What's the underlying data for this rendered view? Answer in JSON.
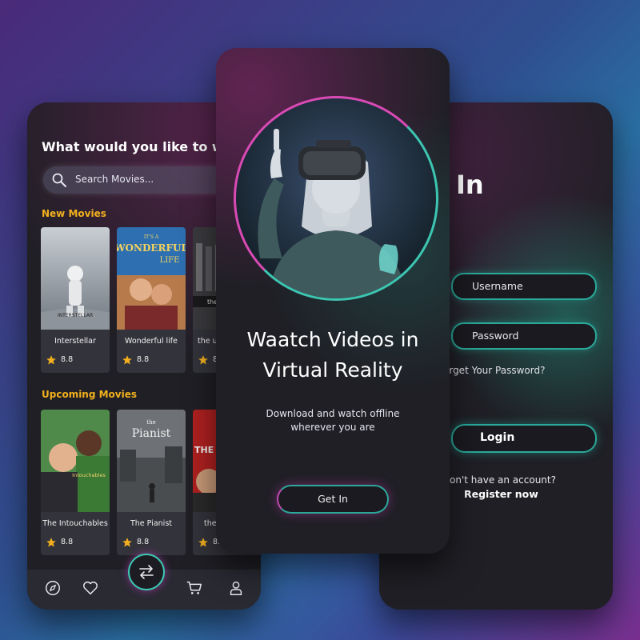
{
  "browse": {
    "greeting": "What would you like to wa",
    "search_placeholder": "Search Movies...",
    "new_movies_label": "New Movies",
    "upcoming_movies_label": "Upcoming Movies",
    "new_movies": [
      {
        "title": "Interstellar",
        "rating": "8.8"
      },
      {
        "title": "Wonderful life",
        "rating": "8.8"
      },
      {
        "title": "the u",
        "rating": "8"
      }
    ],
    "upcoming_movies": [
      {
        "title": "The Intouchables",
        "rating": "8.8"
      },
      {
        "title": "The Pianist",
        "rating": "8.8"
      },
      {
        "title": "the",
        "rating": "8.8"
      }
    ],
    "poster_texts": {
      "interstellar": "INTERSTELLAR",
      "wonderful_small": "IT'S A",
      "wonderful_big": "WONDERFUL",
      "wonderful_life": "LIFE",
      "third_new": "the Usual",
      "intouchables": "Intouchables",
      "pianist_the": "the",
      "pianist": "Pianist",
      "departed": "THE DEPAR"
    },
    "nav_icons": [
      "compass-icon",
      "heart-icon",
      "swap-icon",
      "cart-icon",
      "user-icon"
    ]
  },
  "onboarding": {
    "title_line1": "Waatch Videos in",
    "title_line2": "Virtual Reality",
    "subtitle_line1": "Download and watch offline",
    "subtitle_line2": "wherever you are",
    "cta": "Get In"
  },
  "signin": {
    "title": "In",
    "username_placeholder": "Username",
    "password_placeholder": "Password",
    "forgot": "orget Your Password?",
    "login": "Login",
    "no_account": "on't have an account?",
    "register": "Register now"
  },
  "colors": {
    "accent_teal": "#2aa89a",
    "accent_magenta": "#d94ab5",
    "rating_star": "#f2b01e",
    "section_label": "#f2b01e"
  }
}
